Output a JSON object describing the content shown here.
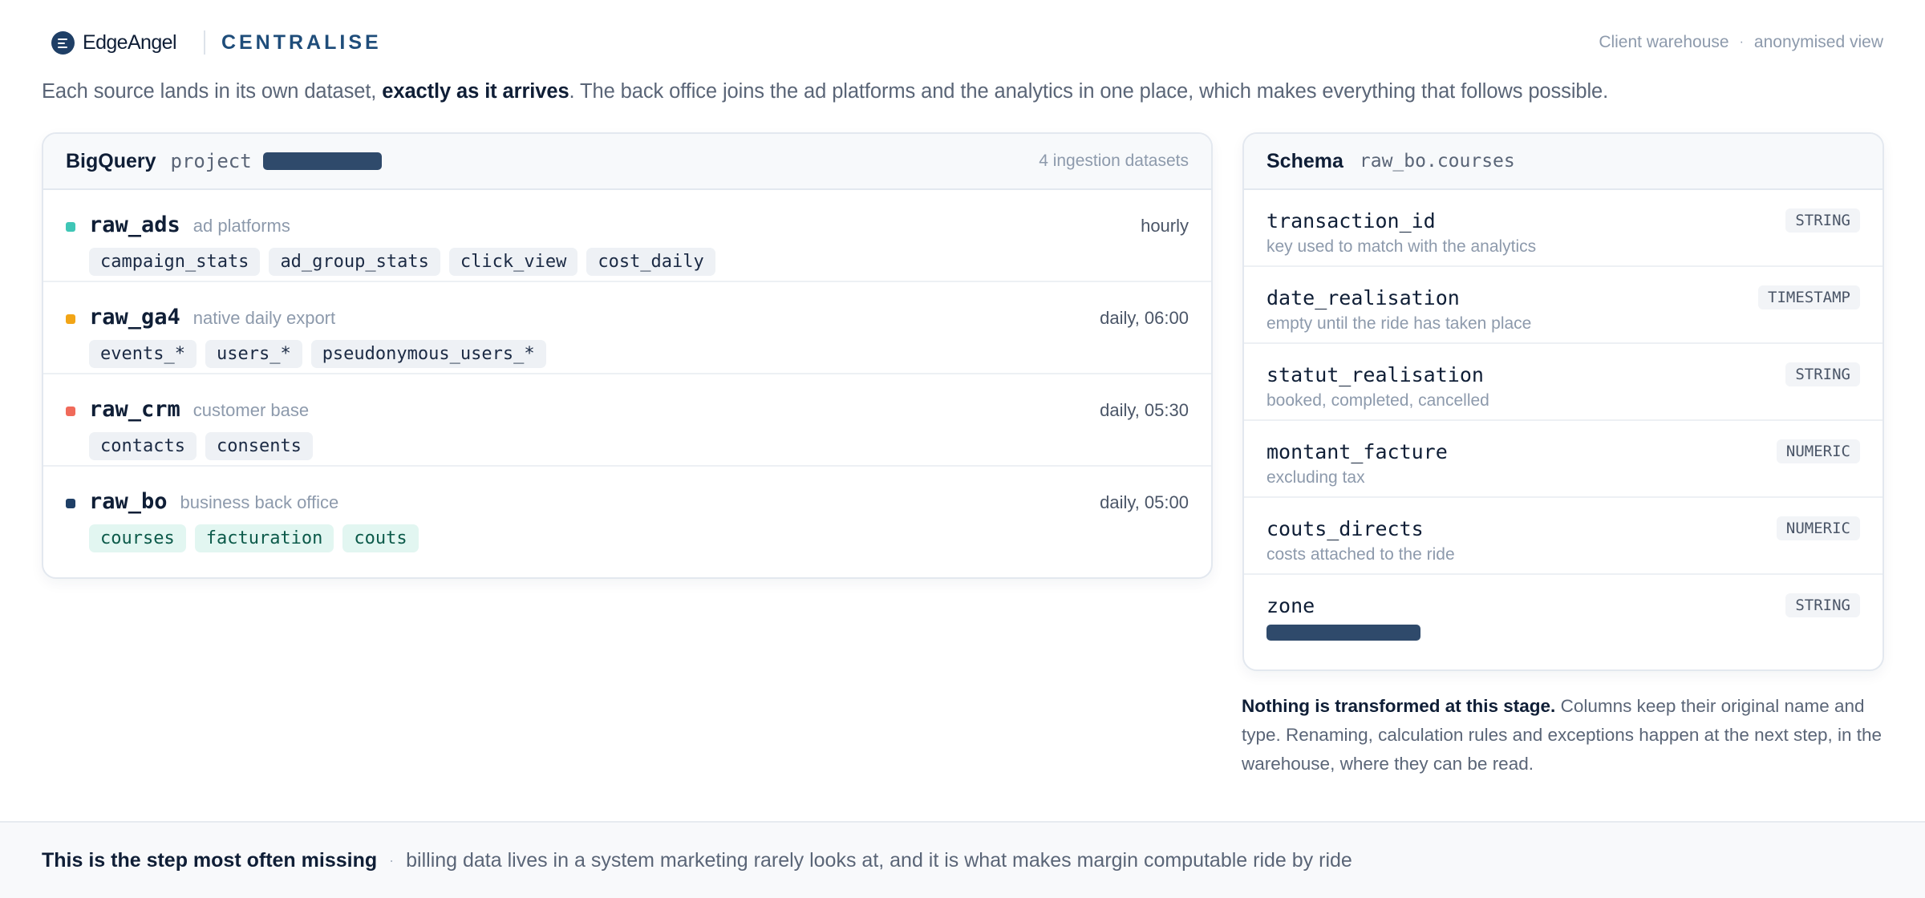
{
  "header": {
    "brand": "EdgeAngel",
    "product": "CENTRALISE",
    "context": "Client warehouse",
    "separator": "·",
    "view": "anonymised view"
  },
  "intro": {
    "before": "Each source lands in its own dataset, ",
    "bold": "exactly as it arrives",
    "after": ". The back office joins the ad platforms and the analytics in one place, which makes everything that follows possible."
  },
  "bigquery": {
    "title": "BigQuery",
    "project_label": "project",
    "dataset_count": "4 ingestion datasets",
    "datasets": [
      {
        "name": "raw_ads",
        "description": "ad platforms",
        "frequency": "hourly",
        "color": "#3fc6b6",
        "tables": [
          "campaign_stats",
          "ad_group_stats",
          "click_view",
          "cost_daily"
        ]
      },
      {
        "name": "raw_ga4",
        "description": "native daily export",
        "frequency": "daily, 06:00",
        "color": "#f2a516",
        "tables": [
          "events_*",
          "users_*",
          "pseudonymous_users_*"
        ]
      },
      {
        "name": "raw_crm",
        "description": "customer base",
        "frequency": "daily, 05:30",
        "color": "#f06a5a",
        "tables": [
          "contacts",
          "consents"
        ]
      },
      {
        "name": "raw_bo",
        "description": "business back office",
        "frequency": "daily, 05:00",
        "color": "#1f3f66",
        "tables": [
          "courses",
          "facturation",
          "couts"
        ]
      }
    ]
  },
  "schema": {
    "title": "Schema",
    "table_path": "raw_bo.courses",
    "columns": [
      {
        "name": "transaction_id",
        "type": "STRING",
        "description": "key used to match with the analytics"
      },
      {
        "name": "date_realisation",
        "type": "TIMESTAMP",
        "description": "empty until the ride has taken place"
      },
      {
        "name": "statut_realisation",
        "type": "STRING",
        "description": "booked, completed, cancelled"
      },
      {
        "name": "montant_facture",
        "type": "NUMERIC",
        "description": "excluding tax"
      },
      {
        "name": "couts_directs",
        "type": "NUMERIC",
        "description": "costs attached to the ride"
      },
      {
        "name": "zone",
        "type": "STRING",
        "description": ""
      }
    ]
  },
  "note": {
    "bold": "Nothing is transformed at this stage.",
    "text": " Columns keep their original name and type. Renaming, calculation rules and exceptions happen at the next step, in the warehouse, where they can be read."
  },
  "footer": {
    "bold": "This is the step most often missing",
    "separator": "·",
    "text": "billing data lives in a system marketing rarely looks at, and it is what makes margin computable ride by ride"
  }
}
